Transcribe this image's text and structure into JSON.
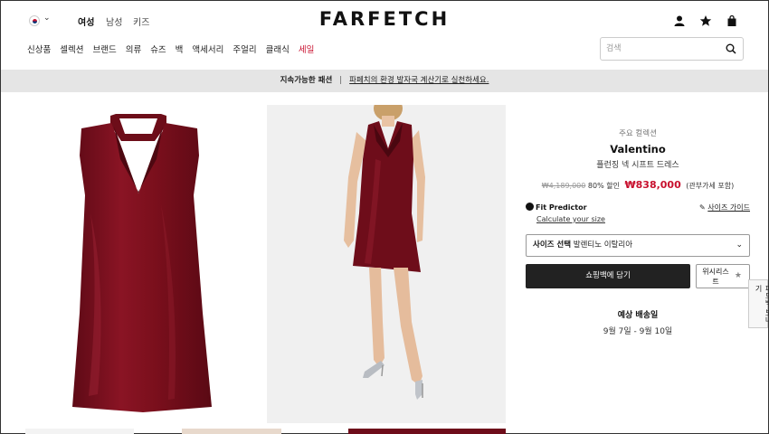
{
  "header": {
    "country_flag_icon": "korea-flag-icon",
    "genders": [
      {
        "label": "여성",
        "active": true
      },
      {
        "label": "남성",
        "active": false
      },
      {
        "label": "키즈",
        "active": false
      }
    ],
    "logo": "FARFETCH",
    "icons": [
      "account-icon",
      "wishlist-star-icon",
      "shopping-bag-icon"
    ]
  },
  "nav": {
    "items": [
      "신상품",
      "셀렉션",
      "브랜드",
      "의류",
      "슈즈",
      "백",
      "액세서리",
      "주얼리",
      "클래식",
      "세일"
    ]
  },
  "search": {
    "placeholder": "검색"
  },
  "banner": {
    "bold": "지속가능한 패션",
    "separator": "|",
    "link": "파페치의 환경 발자국 계산기로 실천하세요."
  },
  "product": {
    "collection": "주요 컬렉션",
    "brand": "Valentino",
    "name": "플런징 넥 시프트 드레스",
    "old_price": "₩4,189,000",
    "discount": "80% 할인",
    "sale_price": "₩838,000",
    "tax_note": "(관부가세 포함)",
    "fit_predictor": "Fit Predictor",
    "calculate_size": "Calculate your size",
    "size_guide": "사이즈 가이드",
    "size_select_label": "사이즈 선택",
    "size_select_value": "발렌티노 이탈리아",
    "add_to_bag": "쇼핑백에 담기",
    "wishlist": "위시리스트",
    "delivery_title": "예상 배송일",
    "delivery_date": "9월 7일 - 9월 10일"
  },
  "feedback": {
    "label": "피드백 보내기"
  },
  "colors": {
    "sale_red": "#c8102e",
    "dress": "#7a0f1c",
    "button_dark": "#222222",
    "banner_bg": "#e5e5e5"
  }
}
